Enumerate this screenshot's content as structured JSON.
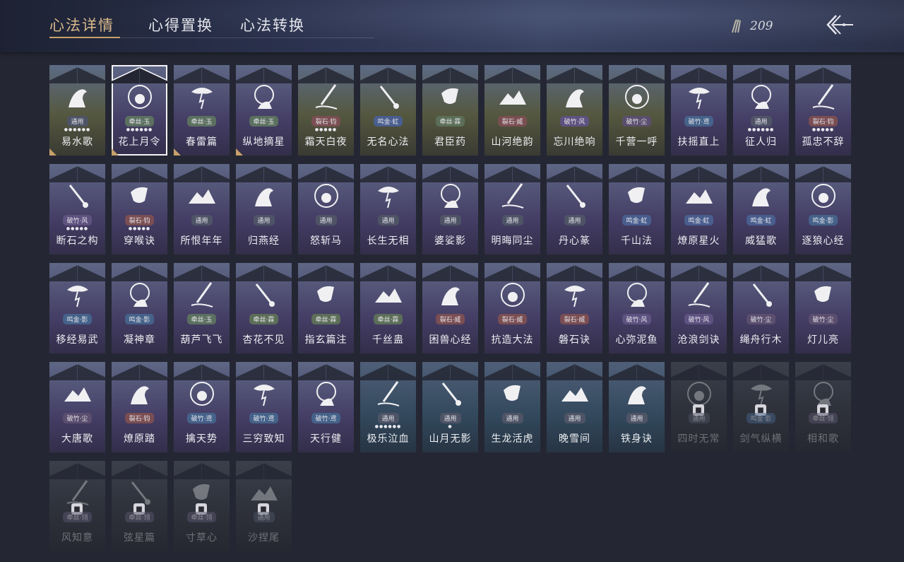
{
  "tabs": [
    {
      "label": "心法详情",
      "active": true
    },
    {
      "label": "心得置换",
      "active": false
    },
    {
      "label": "心法转换",
      "active": false
    }
  ],
  "currency": {
    "value": "209",
    "icon": "arrows-icon"
  },
  "back_icon": "back-arrow-icon",
  "cards": [
    {
      "name": "易水歌",
      "tag": "通用",
      "tone": "tong",
      "style": "gold",
      "dots": "●●●●●●",
      "corner": true,
      "icon": "horse-icon"
    },
    {
      "name": "花上月令",
      "tag": "牵丝·玉",
      "tone": "yu",
      "style": "purple",
      "dots": "●●●●●●",
      "corner": true,
      "selected": true,
      "icon": "flower-moon-icon"
    },
    {
      "name": "春雷篇",
      "tag": "牵丝·玉",
      "tone": "yu",
      "style": "purple",
      "dots": "",
      "corner": true,
      "icon": "tree-lightning-icon"
    },
    {
      "name": "纵地摘星",
      "tag": "牵丝·玉",
      "tone": "yu",
      "style": "purple",
      "dots": "",
      "corner": true,
      "icon": "star-hand-icon"
    },
    {
      "name": "霜天白夜",
      "tag": "裂石·钧",
      "tone": "diao",
      "style": "gold",
      "dots": "●●●●●",
      "icon": "sword-slash-icon"
    },
    {
      "name": "无名心法",
      "tag": "鸣金·虹",
      "tone": "hong",
      "style": "gold",
      "dots": "",
      "icon": "spear-icon"
    },
    {
      "name": "君臣药",
      "tag": "牵丝·霖",
      "tone": "zhen",
      "style": "gold",
      "dots": "",
      "icon": "pour-icon"
    },
    {
      "name": "山河绝韵",
      "tag": "裂石·威",
      "tone": "diao",
      "style": "gold",
      "dots": "",
      "icon": "mountain-icon"
    },
    {
      "name": "忘川绝响",
      "tag": "破竹·风",
      "tone": "feng",
      "style": "gold",
      "dots": "",
      "icon": "mask-icon"
    },
    {
      "name": "千营一呼",
      "tag": "破竹·尘",
      "tone": "chen",
      "style": "gold",
      "dots": "",
      "icon": "flag-icon"
    },
    {
      "name": "扶摇直上",
      "tag": "破竹·鸢",
      "tone": "ying",
      "style": "purple",
      "dots": "",
      "icon": "eagle-icon"
    },
    {
      "name": "征人归",
      "tag": "通用",
      "tone": "tong",
      "style": "purple",
      "dots": "●●●●●●",
      "icon": "bird-hand-icon"
    },
    {
      "name": "孤忠不辞",
      "tag": "裂石·钧",
      "tone": "diao",
      "style": "purple",
      "dots": "●●●●●",
      "icon": "blades-icon"
    },
    {
      "name": "断石之构",
      "tag": "破竹·风",
      "tone": "feng",
      "style": "purple",
      "dots": "●●●●●",
      "icon": "warrior-icon"
    },
    {
      "name": "穿喉诀",
      "tag": "裂石·钧",
      "tone": "diao",
      "style": "purple",
      "dots": "●●●●●",
      "icon": "wave-icon"
    },
    {
      "name": "所恨年年",
      "tag": "通用",
      "tone": "tong",
      "style": "purple",
      "dots": "",
      "icon": "bamboo-icon"
    },
    {
      "name": "归燕经",
      "tag": "通用",
      "tone": "tong",
      "style": "purple",
      "dots": "",
      "icon": "swallow-icon"
    },
    {
      "name": "怒斩马",
      "tag": "通用",
      "tone": "tong",
      "style": "purple",
      "dots": "",
      "icon": "sabre-icon"
    },
    {
      "name": "长生无相",
      "tag": "通用",
      "tone": "tong",
      "style": "purple",
      "dots": "",
      "icon": "statue-icon"
    },
    {
      "name": "婆娑影",
      "tag": "通用",
      "tone": "tong",
      "style": "purple",
      "dots": "",
      "icon": "dragon-icon"
    },
    {
      "name": "明晦同尘",
      "tag": "通用",
      "tone": "tong",
      "style": "purple",
      "dots": "",
      "icon": "snake-icon"
    },
    {
      "name": "丹心篆",
      "tag": "通用",
      "tone": "tong",
      "style": "purple",
      "dots": "",
      "icon": "seal-icon"
    },
    {
      "name": "千山法",
      "tag": "鸣金·虹",
      "tone": "hong",
      "style": "purple",
      "dots": "",
      "icon": "peaks-icon"
    },
    {
      "name": "燎原星火",
      "tag": "鸣金·虹",
      "tone": "hong",
      "style": "purple",
      "dots": "",
      "icon": "glaive-icon"
    },
    {
      "name": "威猛歌",
      "tag": "鸣金·虹",
      "tone": "hong",
      "style": "purple",
      "dots": "",
      "icon": "fist-icon"
    },
    {
      "name": "逐狼心经",
      "tag": "鸣金·影",
      "tone": "ying",
      "style": "purple",
      "dots": "",
      "icon": "wolf-icon"
    },
    {
      "name": "移经易武",
      "tag": "鸣金·影",
      "tone": "ying",
      "style": "purple",
      "dots": "",
      "icon": "armor-icon"
    },
    {
      "name": "凝神章",
      "tag": "鸣金·影",
      "tone": "ying",
      "style": "purple",
      "dots": "",
      "icon": "bow-icon"
    },
    {
      "name": "葫芦飞飞",
      "tag": "牵丝·玉",
      "tone": "yu",
      "style": "purple",
      "dots": "",
      "icon": "gourd-icon"
    },
    {
      "name": "杏花不见",
      "tag": "牵丝·霖",
      "tone": "zhen",
      "style": "purple",
      "dots": "",
      "icon": "blossom-icon"
    },
    {
      "name": "指玄篇注",
      "tag": "牵丝·霖",
      "tone": "zhen",
      "style": "purple",
      "dots": "",
      "icon": "yinyang-icon"
    },
    {
      "name": "千丝蛊",
      "tag": "牵丝·霖",
      "tone": "zhen",
      "style": "purple",
      "dots": "",
      "icon": "leaf-icon"
    },
    {
      "name": "困兽心经",
      "tag": "裂石·威",
      "tone": "diao",
      "style": "purple",
      "dots": "",
      "icon": "beast-icon"
    },
    {
      "name": "抗造大法",
      "tag": "裂石·威",
      "tone": "diao",
      "style": "purple",
      "dots": "",
      "icon": "bell-icon"
    },
    {
      "name": "磐石诀",
      "tag": "裂石·威",
      "tone": "diao",
      "style": "purple",
      "dots": "",
      "icon": "rock-icon"
    },
    {
      "name": "心弥泥鱼",
      "tag": "破竹·风",
      "tone": "feng",
      "style": "purple",
      "dots": "",
      "icon": "fish-icon"
    },
    {
      "name": "沧浪剑诀",
      "tag": "破竹·风",
      "tone": "feng",
      "style": "purple",
      "dots": "",
      "icon": "sea-dragon-icon"
    },
    {
      "name": "绳舟行木",
      "tag": "破竹·尘",
      "tone": "chen",
      "style": "purple",
      "dots": "",
      "icon": "branch-icon"
    },
    {
      "name": "灯儿亮",
      "tag": "破竹·尘",
      "tone": "chen",
      "style": "purple",
      "dots": "",
      "icon": "lantern-icon"
    },
    {
      "name": "大唐歌",
      "tag": "破竹·尘",
      "tone": "chen",
      "style": "purple",
      "dots": "",
      "icon": "city-icon"
    },
    {
      "name": "燎原踏",
      "tag": "裂石·钧",
      "tone": "diao",
      "style": "purple",
      "dots": "",
      "icon": "stallion-icon"
    },
    {
      "name": "擒天势",
      "tag": "破竹·鸢",
      "tone": "ying",
      "style": "purple",
      "dots": "",
      "icon": "chain-icon"
    },
    {
      "name": "三穷致知",
      "tag": "破竹·鸢",
      "tone": "ying",
      "style": "purple",
      "dots": "",
      "icon": "scroll-icon"
    },
    {
      "name": "天行健",
      "tag": "破竹·鸢",
      "tone": "ying",
      "style": "purple",
      "dots": "",
      "icon": "umbrella-icon"
    },
    {
      "name": "极乐泣血",
      "tag": "通用",
      "tone": "tong",
      "style": "teal",
      "dots": "●●●●●●",
      "icon": "dual-blade-icon"
    },
    {
      "name": "山月无影",
      "tag": "通用",
      "tone": "tong",
      "style": "teal",
      "dots": "●",
      "icon": "crescent-blade-icon"
    },
    {
      "name": "生龙活虎",
      "tag": "通用",
      "tone": "tong",
      "style": "teal",
      "dots": "",
      "icon": "spin-icon"
    },
    {
      "name": "晚雪间",
      "tag": "通用",
      "tone": "tong",
      "style": "teal",
      "dots": "",
      "icon": "cross-icon"
    },
    {
      "name": "铁身诀",
      "tag": "通用",
      "tone": "tong",
      "style": "teal",
      "dots": "",
      "icon": "muscle-icon"
    },
    {
      "name": "四时无常",
      "tag": "通用",
      "tone": "tong",
      "style": "locked",
      "dots": "",
      "icon": "dragon-coil-icon"
    },
    {
      "name": "剑气纵横",
      "tag": "鸣金·影",
      "tone": "ying",
      "style": "locked",
      "dots": "",
      "icon": "sword-wind-icon"
    },
    {
      "name": "相和歌",
      "tag": "牵丝·翎",
      "tone": "mi",
      "style": "locked",
      "dots": "",
      "icon": "flute-icon"
    },
    {
      "name": "风知意",
      "tag": "牵丝·翎",
      "tone": "mi",
      "style": "locked",
      "dots": "",
      "icon": "wind-icon"
    },
    {
      "name": "弦星篇",
      "tag": "牵丝·翎",
      "tone": "mi",
      "style": "locked",
      "dots": "",
      "icon": "pipa-icon"
    },
    {
      "name": "寸草心",
      "tag": "牵丝·翎",
      "tone": "mi",
      "style": "locked",
      "dots": "",
      "icon": "herb-icon"
    },
    {
      "name": "沙捏尾",
      "tag": "通用",
      "tone": "tong",
      "style": "locked",
      "dots": "",
      "icon": "spiral-icon"
    }
  ]
}
